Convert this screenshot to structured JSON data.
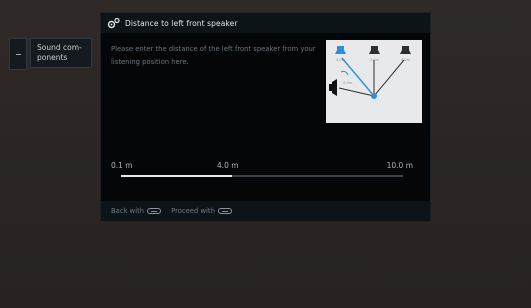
{
  "breadcrumb": {
    "label": "Sound com-\nponents"
  },
  "dialog": {
    "title": "Distance to left front speaker",
    "instruction": "Please enter the distance of the left front speaker from your listening position here."
  },
  "diagram": {
    "speaker_labels": [
      "4.0m",
      "3.0m",
      "4.0m"
    ],
    "side_label": "2.0m"
  },
  "slider": {
    "min_label": "0.1 m",
    "mid_label": "4.0 m",
    "max_label": "10.0 m",
    "current_value": 4.0,
    "min": 0.1,
    "max": 10.0
  },
  "footer": {
    "back_label": "Back with",
    "proceed_label": "Proceed with"
  },
  "colors": {
    "dialog_bg": "#040607",
    "accent_blue": "#2f8fd6"
  },
  "icons": {
    "title_icon": "gear-icon",
    "back_key": "remote-back-key-icon",
    "proceed_key": "remote-ok-key-icon"
  }
}
